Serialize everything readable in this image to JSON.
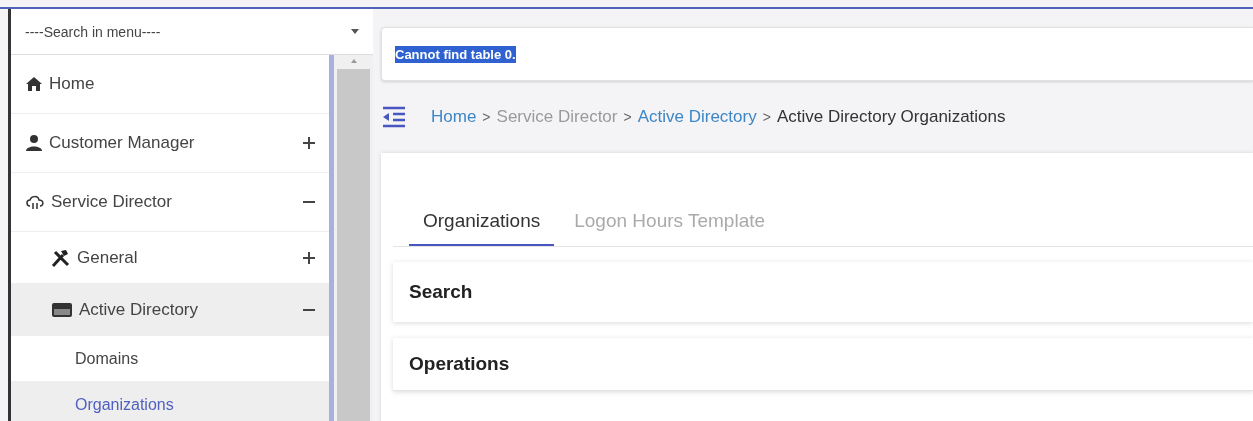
{
  "sidebar": {
    "search": {
      "placeholder": "----Search in menu----"
    },
    "items": [
      {
        "label": "Home",
        "selected": false
      },
      {
        "label": "Customer Manager",
        "expanded": false,
        "selected": false
      },
      {
        "label": "Service Director",
        "expanded": true,
        "selected": false,
        "children": [
          {
            "label": "General",
            "expanded": false,
            "selected": false
          },
          {
            "label": "Active Directory",
            "expanded": true,
            "selected": true,
            "children": [
              {
                "label": "Domains",
                "selected": false
              },
              {
                "label": "Organizations",
                "selected": true
              }
            ]
          }
        ]
      }
    ]
  },
  "message": "Cannot find table 0.",
  "breadcrumb": {
    "separator": ">",
    "items": [
      {
        "label": "Home",
        "kind": "link"
      },
      {
        "label": "Service Director",
        "kind": "plain"
      },
      {
        "label": "Active Directory",
        "kind": "link"
      },
      {
        "label": "Active Directory Organizations",
        "kind": "current"
      }
    ]
  },
  "tabs": [
    {
      "label": "Organizations",
      "selected": true
    },
    {
      "label": "Logon Hours Template",
      "selected": false
    }
  ],
  "panels": [
    {
      "title": "Search"
    },
    {
      "title": "Operations"
    }
  ]
}
